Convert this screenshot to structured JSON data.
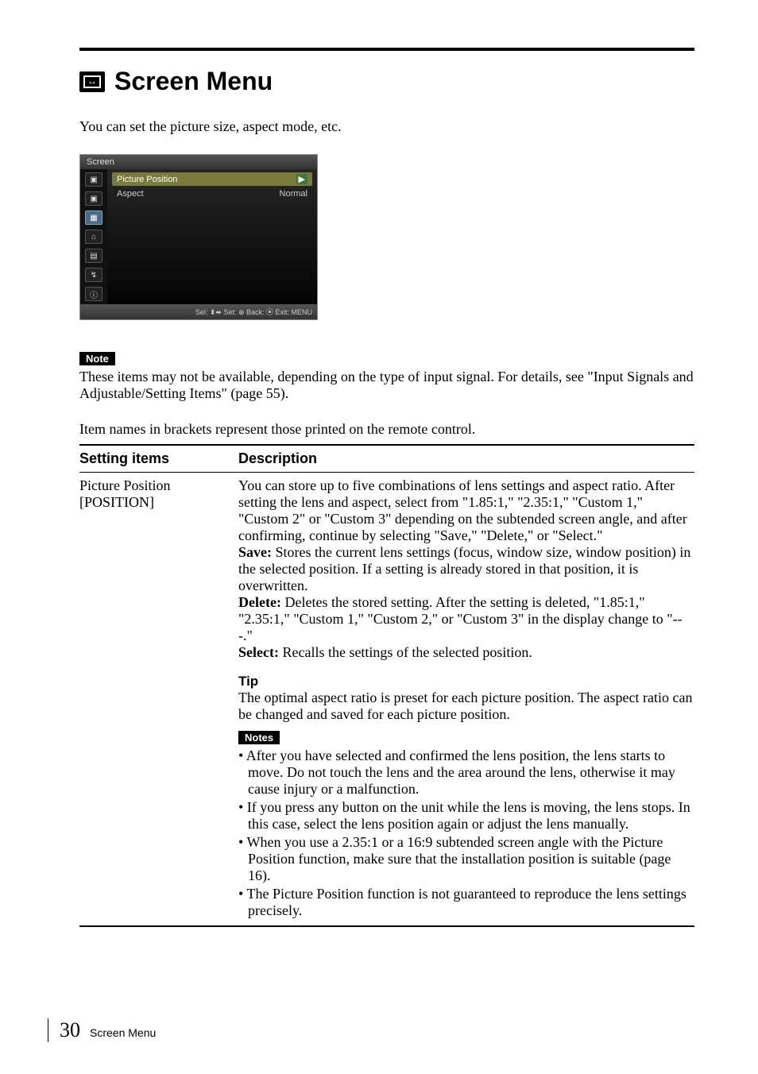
{
  "page": {
    "title": "Screen Menu",
    "intro": "You can set the picture size, aspect mode, etc."
  },
  "osd": {
    "titlebar": "Screen",
    "rows": [
      {
        "label": "Picture Position",
        "value": "",
        "selected": true,
        "arrow": "▶"
      },
      {
        "label": "Aspect",
        "value": "Normal",
        "selected": false
      }
    ],
    "side_icons": [
      "▣",
      "▣",
      "▦",
      "⌂",
      "▤",
      "↯",
      "ⓘ"
    ],
    "selected_side_index": 2,
    "bottom_hints": "Sel: ⬍⬌   Set: ⊕   Back: ⦿   Exit: MENU"
  },
  "note_section": {
    "badge": "Note",
    "text": "These items may not be available, depending on the type of input signal. For details, see \"Input Signals and Adjustable/Setting Items\" (page 55)."
  },
  "table_intro": "Item names in brackets represent those printed on the remote control.",
  "table": {
    "headers": {
      "col1": "Setting items",
      "col2": "Description"
    },
    "row": {
      "item_line1": "Picture Position",
      "item_line2": "[POSITION]",
      "desc_main": "You can store up to five combinations of lens settings and aspect ratio. After setting the lens and aspect, select from \"1.85:1,\" \"2.35:1,\" \"Custom 1,\" \"Custom 2\" or \"Custom 3\" depending on the subtended screen angle, and after confirming, continue by selecting \"Save,\" \"Delete,\" or \"Select.\"",
      "save_label": "Save:",
      "save_text": " Stores the current lens settings (focus, window size, window position) in the selected position. If a setting is already stored in that position, it is overwritten.",
      "delete_label": "Delete:",
      "delete_text": " Deletes the stored setting. After the setting is deleted, \"1.85:1,\" \"2.35:1,\" \"Custom 1,\" \"Custom 2,\" or \"Custom 3\" in the display change to \"---.\"",
      "select_label": "Select:",
      "select_text": " Recalls the settings of the selected position.",
      "tip_head": "Tip",
      "tip_text": "The optimal aspect ratio is preset for each picture position. The aspect ratio can be changed and saved for each picture position.",
      "notes_badge": "Notes",
      "bullets": [
        "• After you have selected and confirmed the lens position, the lens starts to move. Do not touch the lens and the area around the lens, otherwise it may cause injury or a malfunction.",
        "• If you press any button on the unit while the lens is moving, the lens stops. In this case, select the lens position again or adjust the lens manually.",
        "• When you use a 2.35:1 or a 16:9 subtended screen angle with the Picture Position function, make sure that the installation position is suitable (page 16).",
        "• The Picture Position function is not guaranteed to reproduce the lens settings precisely."
      ]
    }
  },
  "footer": {
    "page_number": "30",
    "section": "Screen Menu"
  }
}
